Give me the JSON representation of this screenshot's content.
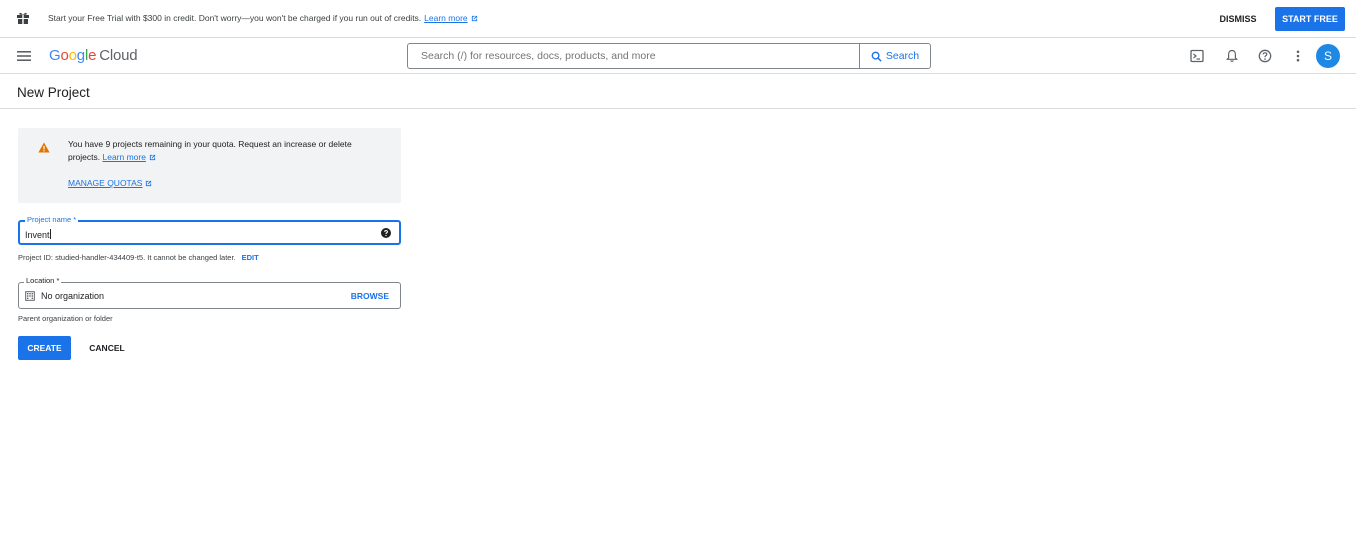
{
  "banner": {
    "text": "Start your Free Trial with $300 in credit. Don't worry—you won't be charged if you run out of credits.",
    "link": "Learn more",
    "dismiss": "DISMISS",
    "start_free": "START FREE"
  },
  "header": {
    "logo_google": [
      "G",
      "o",
      "o",
      "g",
      "l",
      "e"
    ],
    "logo_cloud": "Cloud",
    "search_placeholder": "Search (/) for resources, docs, products, and more",
    "search_button": "Search",
    "avatar_initial": "S"
  },
  "page": {
    "title": "New Project"
  },
  "quota": {
    "text": "You have 9 projects remaining in your quota. Request an increase or delete projects.",
    "learn_more": "Learn more",
    "manage": "MANAGE QUOTAS"
  },
  "form": {
    "project_name_label": "Project name *",
    "project_name_value": "Invent",
    "project_id_text": "Project ID: studied-handler-434409-t5. It cannot be changed later.",
    "edit": "EDIT",
    "location_label": "Location *",
    "location_value": "No organization",
    "browse": "BROWSE",
    "location_helper": "Parent organization or folder",
    "create": "CREATE",
    "cancel": "CANCEL"
  },
  "colors": {
    "accent": "#1a73e8",
    "warning": "#e37400"
  }
}
